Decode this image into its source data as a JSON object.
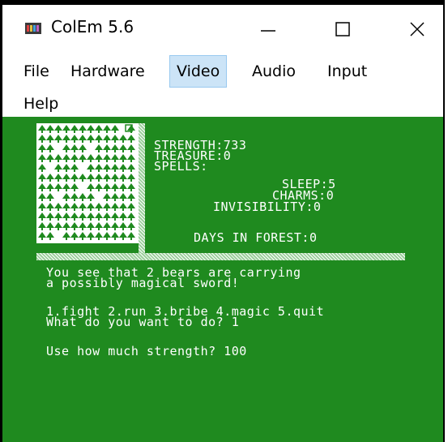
{
  "window": {
    "title": "ColEm 5.6",
    "icon": "colem-app-icon"
  },
  "controls": {
    "minimize_icon": "minimize-icon",
    "maximize_icon": "maximize-icon",
    "close_icon": "close-icon"
  },
  "menu": {
    "items": [
      {
        "label": "File"
      },
      {
        "label": "Hardware"
      },
      {
        "label": "Video",
        "active": true
      },
      {
        "label": "Audio"
      },
      {
        "label": "Input"
      },
      {
        "label": "Help"
      }
    ]
  },
  "game": {
    "stats": {
      "strength": "STRENGTH:733",
      "treasure": "TREASURE:0",
      "spells": "SPELLS:",
      "sleep": "SLEEP:5",
      "charms": "CHARMS:0",
      "invisibility": "INVISIBILITY:0",
      "days": "DAYS IN FOREST:0"
    },
    "messages": {
      "line1": "You see that 2 bears are carrying",
      "line2": "a possibly magical sword!",
      "line3": "1.fight 2.run 3.bribe 4.magic 5.quit",
      "line4": "What do you want to do? 1",
      "line5": "Use how much strength? 100"
    }
  },
  "colors": {
    "screen_bg": "#1f8a1f",
    "text": "#ffffff",
    "menu_active_bg": "#cce4f7"
  }
}
